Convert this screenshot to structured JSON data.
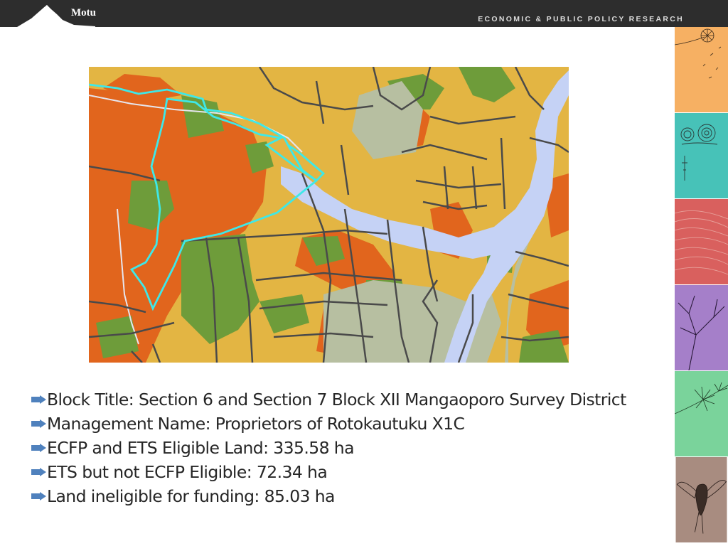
{
  "header": {
    "logo_text": "Motu",
    "tagline": "ECONOMIC & PUBLIC POLICY RESEARCH",
    "background": "#2d2d2d"
  },
  "side_tiles": [
    {
      "name": "dandelion",
      "color": "#f6b063"
    },
    {
      "name": "snail",
      "color": "#47c2b8"
    },
    {
      "name": "contour-lines",
      "color": "#d9605e"
    },
    {
      "name": "tree-branches",
      "color": "#a57fc9"
    },
    {
      "name": "pine-branch",
      "color": "#7ad39b"
    },
    {
      "name": "bird",
      "color": "#a88c80"
    }
  ],
  "map": {
    "boundary_color": "#3ee8e8",
    "palette": {
      "background": "#b7bfa1",
      "river": "#c5d2f5",
      "eligible_orange": "#e1651d",
      "forest_green": "#6e9c3a",
      "pasture_yellow": "#e3b543",
      "parcel_line": "#4a4a4a"
    }
  },
  "bullets": [
    {
      "text": "Block Title: Section 6 and Section 7 Block XII Mangaoporo Survey District"
    },
    {
      "text": "Management Name: Proprietors of Rotokautuku X1C"
    },
    {
      "text": "ECFP and ETS Eligible Land: 335.58 ha"
    },
    {
      "text": "ETS but not ECFP Eligible: 72.34 ha"
    },
    {
      "text": "Land ineligible for funding: 85.03 ha"
    }
  ]
}
